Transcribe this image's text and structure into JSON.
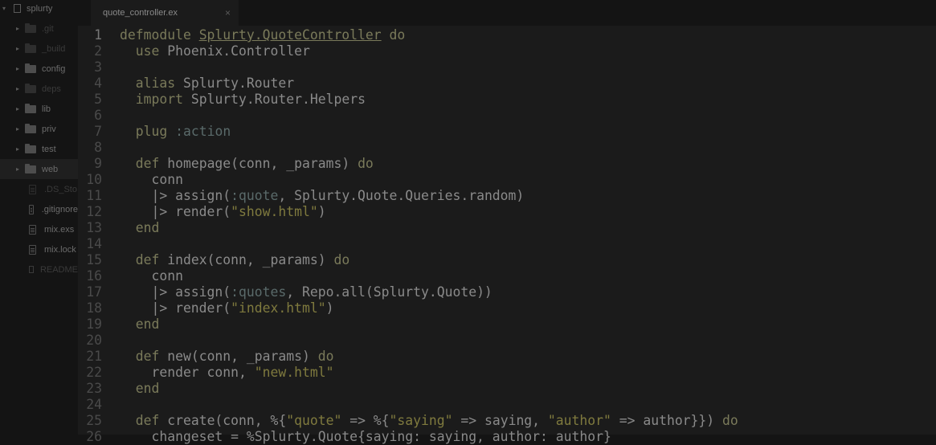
{
  "sidebar": {
    "project": "splurty",
    "items": [
      {
        "label": ".git",
        "type": "folder",
        "dim": true
      },
      {
        "label": "_build",
        "type": "folder",
        "dim": true
      },
      {
        "label": "config",
        "type": "folder",
        "dim": false
      },
      {
        "label": "deps",
        "type": "folder",
        "dim": true
      },
      {
        "label": "lib",
        "type": "folder",
        "dim": false
      },
      {
        "label": "priv",
        "type": "folder",
        "dim": false
      },
      {
        "label": "test",
        "type": "folder",
        "dim": false
      },
      {
        "label": "web",
        "type": "folder",
        "dim": false,
        "active": true
      },
      {
        "label": ".DS_Sto",
        "type": "file",
        "dim": true
      },
      {
        "label": ".gitignore",
        "type": "file",
        "dim": false
      },
      {
        "label": "mix.exs",
        "type": "file",
        "dim": false
      },
      {
        "label": "mix.lock",
        "type": "file",
        "dim": false
      },
      {
        "label": "README",
        "type": "book",
        "dim": true
      }
    ]
  },
  "tab": {
    "title": "quote_controller.ex",
    "close": "×"
  },
  "editor": {
    "current_line": 1,
    "lines": [
      {
        "n": "1",
        "code": "defmodule Splurty.QuoteController do"
      },
      {
        "n": "2",
        "code": "  use Phoenix.Controller"
      },
      {
        "n": "3",
        "code": ""
      },
      {
        "n": "4",
        "code": "  alias Splurty.Router"
      },
      {
        "n": "5",
        "code": "  import Splurty.Router.Helpers"
      },
      {
        "n": "6",
        "code": ""
      },
      {
        "n": "7",
        "code": "  plug :action"
      },
      {
        "n": "8",
        "code": ""
      },
      {
        "n": "9",
        "code": "  def homepage(conn, _params) do"
      },
      {
        "n": "10",
        "code": "    conn"
      },
      {
        "n": "11",
        "code": "    |> assign(:quote, Splurty.Quote.Queries.random)"
      },
      {
        "n": "12",
        "code": "    |> render(\"show.html\")"
      },
      {
        "n": "13",
        "code": "  end"
      },
      {
        "n": "14",
        "code": ""
      },
      {
        "n": "15",
        "code": "  def index(conn, _params) do"
      },
      {
        "n": "16",
        "code": "    conn"
      },
      {
        "n": "17",
        "code": "    |> assign(:quotes, Repo.all(Splurty.Quote))"
      },
      {
        "n": "18",
        "code": "    |> render(\"index.html\")"
      },
      {
        "n": "19",
        "code": "  end"
      },
      {
        "n": "20",
        "code": ""
      },
      {
        "n": "21",
        "code": "  def new(conn, _params) do"
      },
      {
        "n": "22",
        "code": "    render conn, \"new.html\""
      },
      {
        "n": "23",
        "code": "  end"
      },
      {
        "n": "24",
        "code": ""
      },
      {
        "n": "25",
        "code": "  def create(conn, %{\"quote\" => %{\"saying\" => saying, \"author\" => author}}) do"
      },
      {
        "n": "26",
        "code": "    changeset = %Splurty.Quote{saying: saying, author: author}"
      }
    ]
  }
}
